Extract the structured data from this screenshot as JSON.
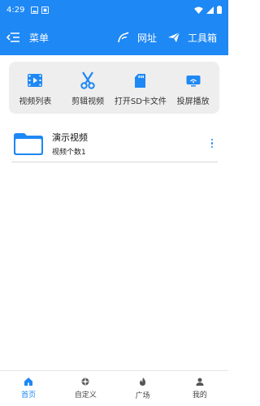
{
  "status": {
    "time": "4:29"
  },
  "header": {
    "menu_label": "菜单",
    "web_label": "网址",
    "tools_label": "工具箱"
  },
  "tools": [
    {
      "label": "视频列表",
      "icon": "video-list-icon"
    },
    {
      "label": "剪辑视频",
      "icon": "scissors-icon"
    },
    {
      "label": "打开SD卡文件",
      "icon": "sd-card-icon"
    },
    {
      "label": "投屏播放",
      "icon": "cast-icon"
    }
  ],
  "folders": [
    {
      "name": "演示视频",
      "count": "视频个数1"
    }
  ],
  "nav": [
    {
      "label": "首页",
      "icon": "home-icon",
      "active": true
    },
    {
      "label": "自定义",
      "icon": "custom-icon",
      "active": false
    },
    {
      "label": "广场",
      "icon": "square-icon",
      "active": false
    },
    {
      "label": "我的",
      "icon": "profile-icon",
      "active": false
    }
  ],
  "colors": {
    "primary": "#1e88f5",
    "card_bg": "#eeeeee",
    "divider": "#d8d8d8"
  }
}
